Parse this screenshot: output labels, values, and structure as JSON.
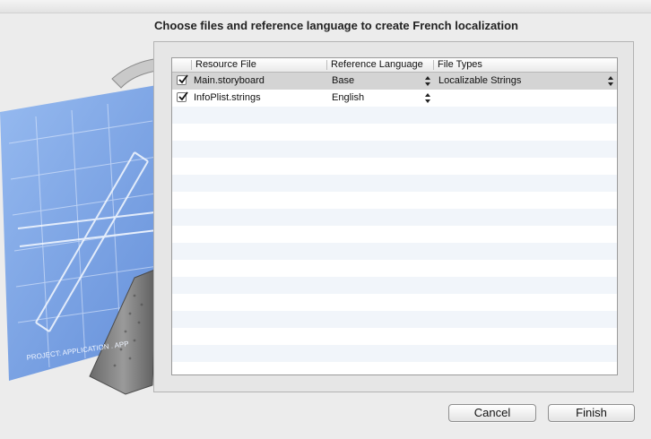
{
  "dialog": {
    "title": "Choose files and reference language to create French localization"
  },
  "table": {
    "columns": {
      "resource_file": "Resource File",
      "reference_language": "Reference Language",
      "file_types": "File Types"
    },
    "rows": [
      {
        "checked": true,
        "resource_file": "Main.storyboard",
        "reference_language": "Base",
        "file_types": "Localizable Strings",
        "selected": true
      },
      {
        "checked": true,
        "resource_file": "InfoPlist.strings",
        "reference_language": "English",
        "file_types": "",
        "selected": false
      }
    ],
    "empty_row_count": 16
  },
  "buttons": {
    "cancel": "Cancel",
    "finish": "Finish"
  },
  "art": {
    "blueprint_caption": "PROJECT: APPLICATION . APP"
  },
  "colors": {
    "stripe": "#f1f5fa",
    "selected_row": "#d4d4d4",
    "blueprint": "#6e9be6"
  }
}
